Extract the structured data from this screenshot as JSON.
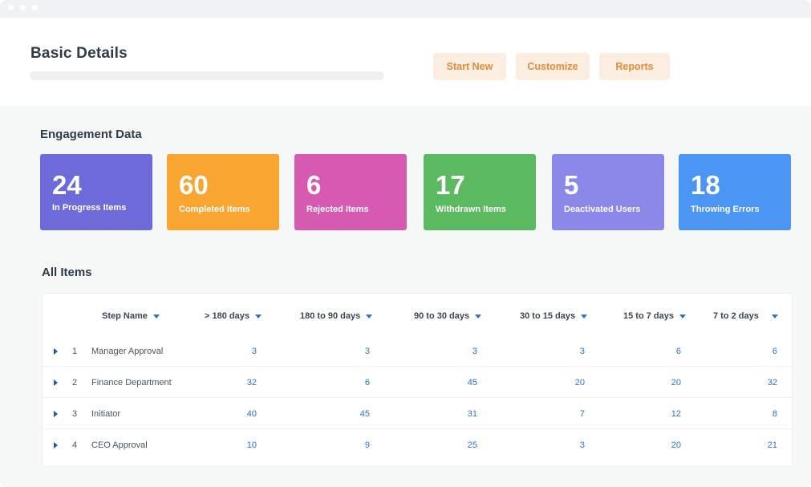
{
  "header": {
    "title": "Basic Details",
    "buttons": [
      "Start New",
      "Customize",
      "Reports"
    ]
  },
  "engagement": {
    "title": "Engagement Data",
    "cards": [
      {
        "value": "24",
        "label": "In Progress Items",
        "color": "#6e6ad9"
      },
      {
        "value": "60",
        "label": "Completed Items",
        "color": "#f9a531"
      },
      {
        "value": "6",
        "label": "Rejected Items",
        "color": "#d75ab1"
      },
      {
        "value": "17",
        "label": "Withdrawn Items",
        "color": "#5bb960"
      },
      {
        "value": "5",
        "label": "Deactivated Users",
        "color": "#8b88ea"
      },
      {
        "value": "18",
        "label": "Throwing Errors",
        "color": "#4b95f5"
      }
    ]
  },
  "all_items": {
    "title": "All Items",
    "columns": [
      "Step Name",
      "> 180 days",
      "180 to 90 days",
      "90 to 30 days",
      "30 to 15 days",
      "15 to 7 days",
      "7 to 2 days"
    ],
    "rows": [
      {
        "index": "1",
        "name": "Manager Approval",
        "values": [
          "3",
          "3",
          "3",
          "3",
          "6",
          "6"
        ]
      },
      {
        "index": "2",
        "name": "Finance Department",
        "values": [
          "32",
          "6",
          "45",
          "20",
          "20",
          "32"
        ]
      },
      {
        "index": "3",
        "name": "Initiator",
        "values": [
          "40",
          "45",
          "31",
          "7",
          "12",
          "8"
        ]
      },
      {
        "index": "4",
        "name": "CEO Approval",
        "values": [
          "10",
          "9",
          "25",
          "3",
          "20",
          "21"
        ]
      }
    ]
  },
  "icons": {
    "sort": "caret-down-icon",
    "expand": "caret-right-icon",
    "accent": "#2f6fd6",
    "button_text": "#e88a3c",
    "button_bg": "#fbeee0"
  }
}
